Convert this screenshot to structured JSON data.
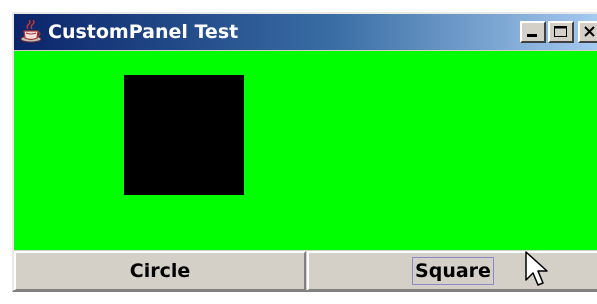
{
  "window": {
    "title": "CustomPanel Test",
    "icon": "java-cup-icon",
    "controls": [
      "minimize-icon",
      "maximize-icon",
      "close-icon"
    ]
  },
  "panel": {
    "background_color": "#00ff00",
    "shape": "square",
    "shape_color": "#000000"
  },
  "buttons": {
    "circle_label": "Circle",
    "square_label": "Square",
    "focused": "Square"
  },
  "colors": {
    "titlebar_start": "#0a246a",
    "titlebar_end": "#a6caf0",
    "chrome": "#d4d0c8"
  }
}
